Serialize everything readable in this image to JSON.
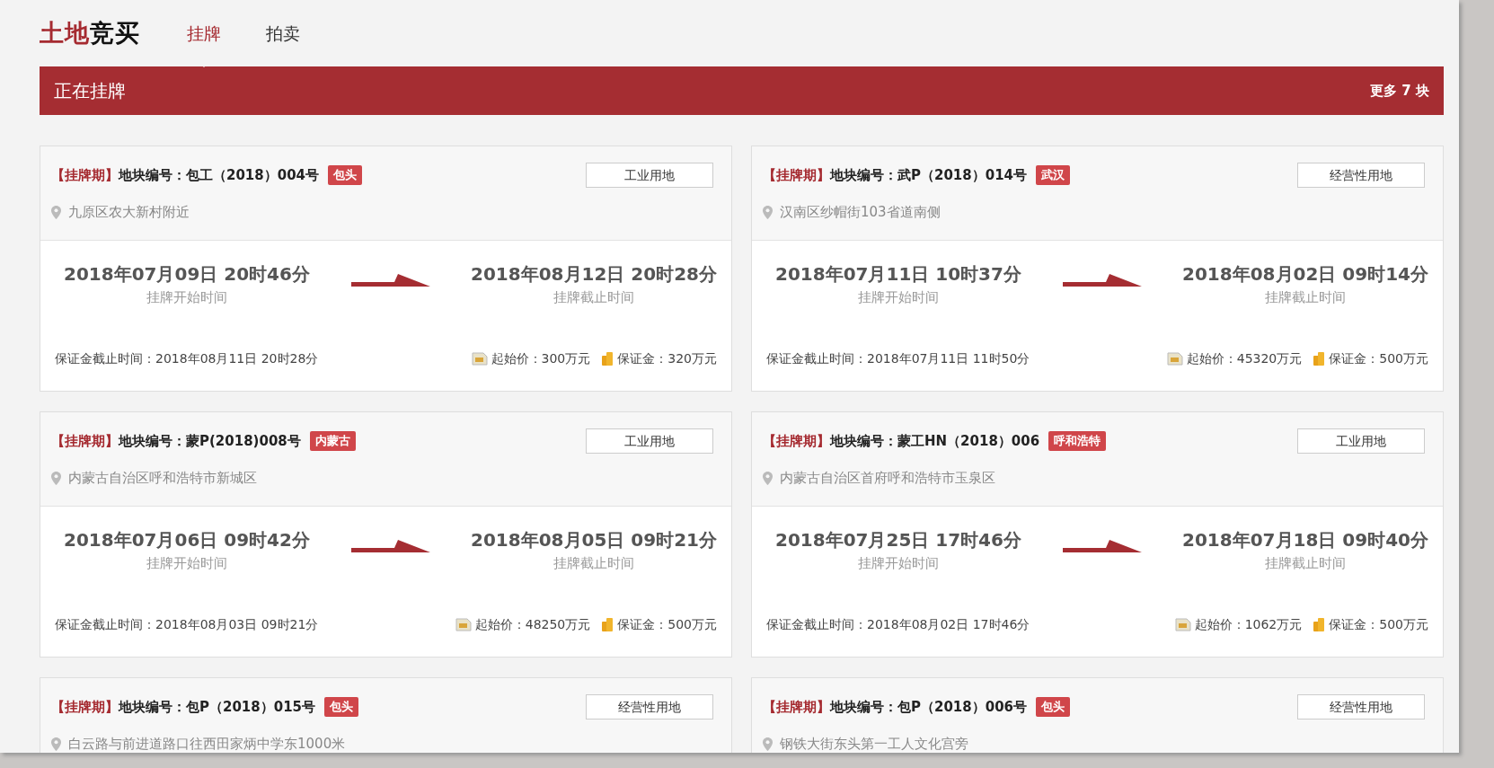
{
  "brand": {
    "accent": "土地",
    "rest": "竞买"
  },
  "tabs": [
    {
      "label": "挂牌",
      "selected": true
    },
    {
      "label": "拍卖",
      "selected": false
    }
  ],
  "banner": {
    "title": "正在挂牌",
    "more": "更多 7 块"
  },
  "listings": [
    {
      "period": "【挂牌期】",
      "code": "地块编号：包工（2018）004号",
      "city": "包头",
      "land_use": "工业用地",
      "address": "九原区农大新村附近",
      "start_time": "2018年07月09日 20时46分",
      "start_label": "挂牌开始时间",
      "end_time": "2018年08月12日 20时28分",
      "end_label": "挂牌截止时间",
      "deposit_deadline": "保证金截止时间：2018年08月11日 20时28分",
      "start_price": "起始价：300万元",
      "deposit": "保证金：320万元"
    },
    {
      "period": "【挂牌期】",
      "code": "地块编号：武P（2018）014号",
      "city": "武汉",
      "land_use": "经营性用地",
      "address": "汉南区纱帽街103省道南侧",
      "start_time": "2018年07月11日 10时37分",
      "start_label": "挂牌开始时间",
      "end_time": "2018年08月02日 09时14分",
      "end_label": "挂牌截止时间",
      "deposit_deadline": "保证金截止时间：2018年07月11日 11时50分",
      "start_price": "起始价：45320万元",
      "deposit": "保证金：500万元"
    },
    {
      "period": "【挂牌期】",
      "code": "地块编号：蒙P(2018)008号",
      "city": "内蒙古",
      "land_use": "工业用地",
      "address": "内蒙古自治区呼和浩特市新城区",
      "start_time": "2018年07月06日 09时42分",
      "start_label": "挂牌开始时间",
      "end_time": "2018年08月05日 09时21分",
      "end_label": "挂牌截止时间",
      "deposit_deadline": "保证金截止时间：2018年08月03日 09时21分",
      "start_price": "起始价：48250万元",
      "deposit": "保证金：500万元"
    },
    {
      "period": "【挂牌期】",
      "code": "地块编号：蒙工HN（2018）006",
      "city": "呼和浩特",
      "land_use": "工业用地",
      "address": "内蒙古自治区首府呼和浩特市玉泉区",
      "start_time": "2018年07月25日 17时46分",
      "start_label": "挂牌开始时间",
      "end_time": "2018年07月18日 09时40分",
      "end_label": "挂牌截止时间",
      "deposit_deadline": "保证金截止时间：2018年08月02日 17时46分",
      "start_price": "起始价：1062万元",
      "deposit": "保证金：500万元"
    },
    {
      "period": "【挂牌期】",
      "code": "地块编号：包P（2018）015号",
      "city": "包头",
      "land_use": "经营性用地",
      "address": "白云路与前进道路口往西田家炳中学东1000米"
    },
    {
      "period": "【挂牌期】",
      "code": "地块编号：包P（2018）006号",
      "city": "包头",
      "land_use": "经营性用地",
      "address": "钢铁大街东头第一工人文化宫旁"
    }
  ]
}
